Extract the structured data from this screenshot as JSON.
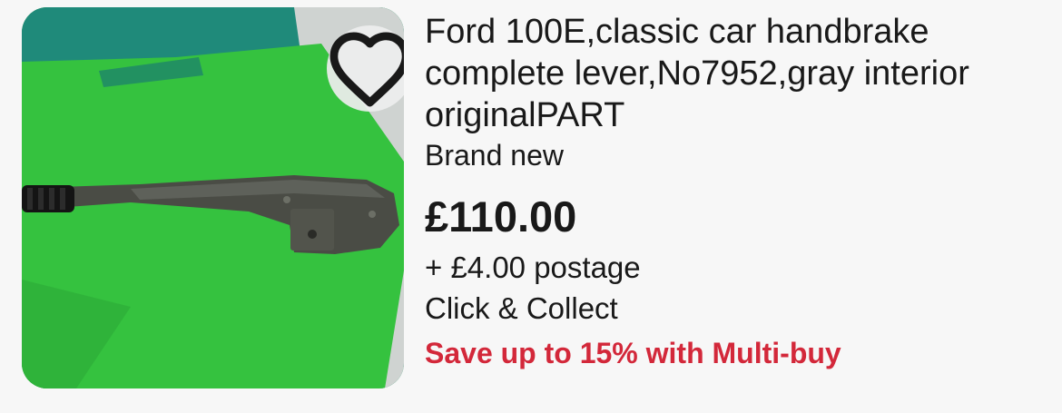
{
  "listing": {
    "title": "Ford 100E,classic car handbrake complete lever,No7952,gray interior originalPART",
    "condition": "Brand new",
    "price": "£110.00",
    "shipping": "+ £4.00 postage",
    "collection": "Click & Collect",
    "promotion": "Save up to 15% with Multi-buy"
  },
  "watch_button": {
    "icon": "heart-outline-icon"
  },
  "colors": {
    "promotion": "#d3283a",
    "text": "#191919",
    "background": "#f7f7f7"
  }
}
